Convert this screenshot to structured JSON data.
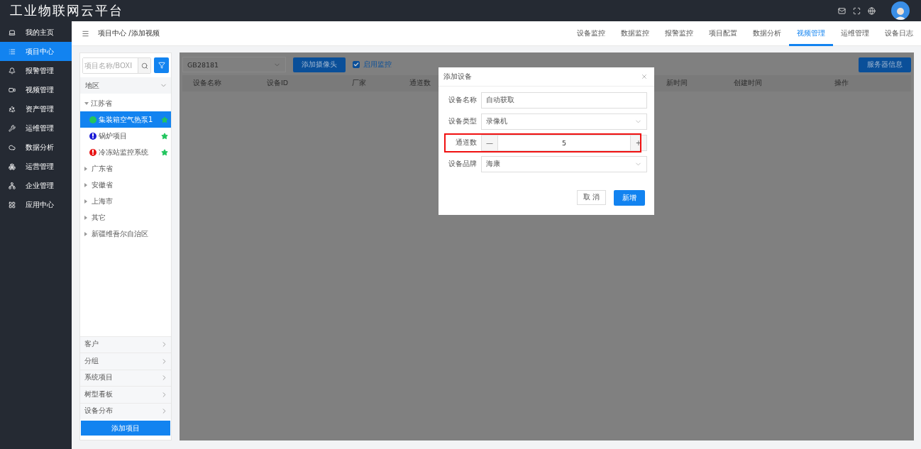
{
  "app": {
    "title": "工业物联网云平台"
  },
  "header_icons": [
    {
      "kind": "mail"
    },
    {
      "kind": "fullscreen"
    },
    {
      "kind": "globe"
    }
  ],
  "sidebar": {
    "items": [
      {
        "label": "我的主页",
        "selected": false
      },
      {
        "label": "项目中心",
        "selected": true
      },
      {
        "label": "报警管理",
        "selected": false
      },
      {
        "label": "视频管理",
        "selected": false
      },
      {
        "label": "资产管理",
        "selected": false
      },
      {
        "label": "运维管理",
        "selected": false
      },
      {
        "label": "数据分析",
        "selected": false
      },
      {
        "label": "运营管理",
        "selected": false
      },
      {
        "label": "企业管理",
        "selected": false
      },
      {
        "label": "应用中心",
        "selected": false
      }
    ]
  },
  "breadcrumb": "项目中心 /添加视频",
  "tabs": [
    {
      "label": "设备监控",
      "selected": false
    },
    {
      "label": "数据监控",
      "selected": false
    },
    {
      "label": "报警监控",
      "selected": false
    },
    {
      "label": "项目配置",
      "selected": false
    },
    {
      "label": "数据分析",
      "selected": false
    },
    {
      "label": "视频管理",
      "selected": true
    },
    {
      "label": "运维管理",
      "selected": false
    },
    {
      "label": "设备日志",
      "selected": false
    }
  ],
  "project_panel": {
    "search_placeholder": "项目名称/BOXI",
    "section": "地区",
    "tree": [
      {
        "label": "江苏省",
        "expanded": true,
        "children": [
          {
            "label": "集装箱空气热泵1",
            "kind": "dot",
            "color": "#22c55e",
            "starred": true,
            "selected": true
          },
          {
            "label": "锅炉项目",
            "kind": "alert",
            "color": "#1d1dd6",
            "starred": true,
            "selected": false
          },
          {
            "label": "冷冻站监控系统",
            "kind": "alert",
            "color": "#e81515",
            "starred": true,
            "selected": false
          }
        ]
      },
      {
        "label": "广东省",
        "expanded": false
      },
      {
        "label": "安徽省",
        "expanded": false
      },
      {
        "label": "上海市",
        "expanded": false
      },
      {
        "label": "其它",
        "expanded": false
      },
      {
        "label": "新疆维吾尔自治区",
        "expanded": false
      }
    ],
    "groups": [
      "客户",
      "分组",
      "系统项目",
      "树型看板",
      "设备分布"
    ],
    "add_button": "添加项目"
  },
  "video_panel": {
    "protocol": "GB28181",
    "add_button": "添加摄像头",
    "monitor": {
      "label": "启用监控",
      "checked": true
    },
    "server_button": "服务器信息",
    "columns": [
      "设备名称",
      "设备ID",
      "厂家",
      "通道数",
      "新时间",
      "创建时间",
      "操作"
    ]
  },
  "dialog": {
    "title": "添加设备",
    "fields": [
      {
        "kind": "text",
        "label": "设备名称",
        "value": "自动获取"
      },
      {
        "kind": "select",
        "label": "设备类型",
        "value": "录像机"
      },
      {
        "kind": "number",
        "label": "通道数",
        "value": "5",
        "highlighted": true,
        "minus": "—",
        "plus": "+"
      },
      {
        "kind": "select",
        "label": "设备品牌",
        "value": "海康"
      }
    ],
    "cancel": "取 消",
    "confirm": "新增"
  }
}
